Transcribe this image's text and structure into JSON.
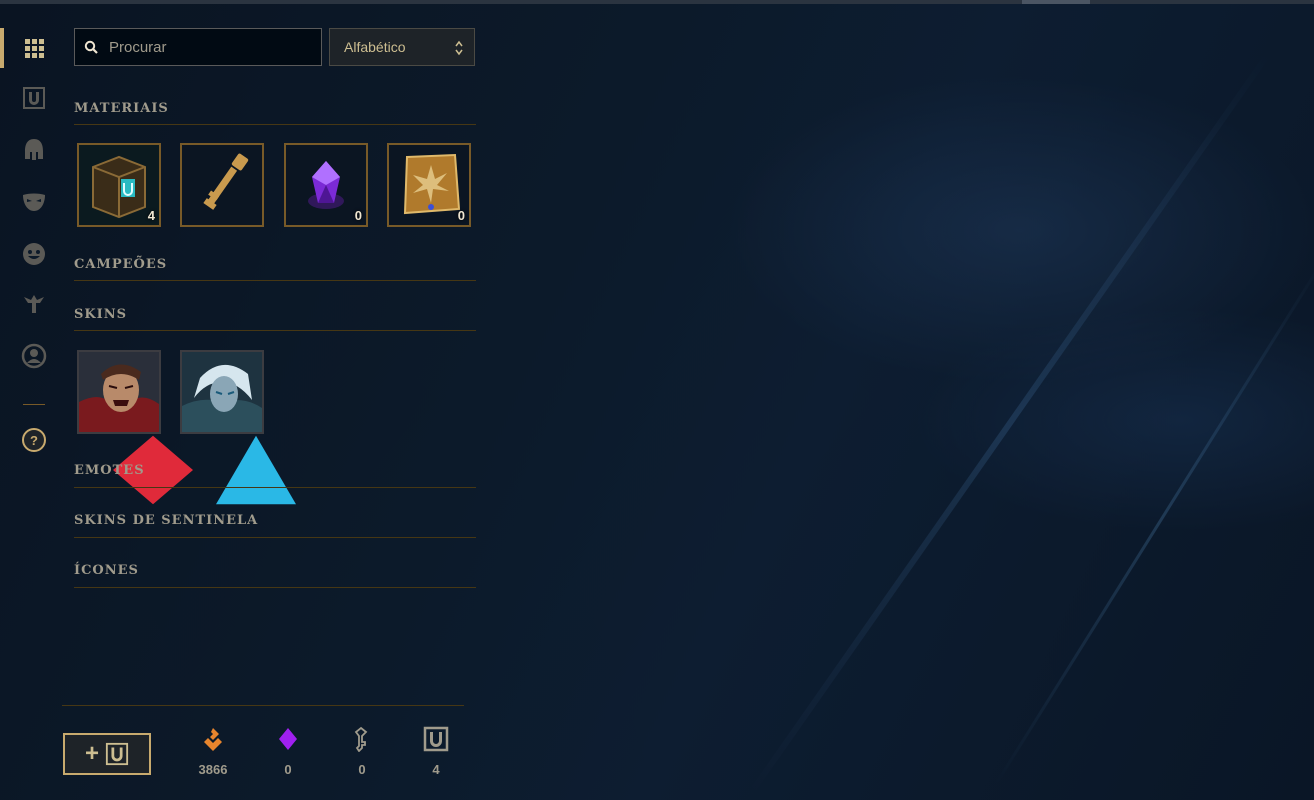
{
  "search": {
    "placeholder": "Procurar"
  },
  "sort": {
    "selected": "Alfabético"
  },
  "sidebar": {
    "items": [
      {
        "icon": "grid-icon",
        "active": true
      },
      {
        "icon": "chest-icon",
        "active": false
      },
      {
        "icon": "helmet-icon",
        "active": false
      },
      {
        "icon": "mask-icon",
        "active": false
      },
      {
        "icon": "emote-face-icon",
        "active": false
      },
      {
        "icon": "ward-icon",
        "active": false
      },
      {
        "icon": "profile-icon",
        "active": false
      }
    ],
    "help_label": "?"
  },
  "sections": {
    "materials": "MATERIAIS",
    "champions": "CAMPEÕES",
    "skins": "SKINS",
    "emotes": "EMOTES",
    "ward_skins": "SKINS DE SENTINELA",
    "icons": "ÍCONES"
  },
  "materials": [
    {
      "name": "hextech-chest",
      "count": "4"
    },
    {
      "name": "hextech-key",
      "count": ""
    },
    {
      "name": "mythic-essence",
      "count": "0"
    },
    {
      "name": "masterwork-card",
      "count": "0"
    }
  ],
  "skins": [
    {
      "name": "skin-shard-1",
      "gem": "red"
    },
    {
      "name": "skin-shard-2",
      "gem": "blue"
    }
  ],
  "footer": {
    "open_button": "+",
    "currencies": [
      {
        "icon": "orange-essence-icon",
        "value": "3866"
      },
      {
        "icon": "mythic-essence-icon",
        "value": "0"
      },
      {
        "icon": "key-fragment-icon",
        "value": "0"
      },
      {
        "icon": "chest-count-icon",
        "value": "4"
      }
    ]
  },
  "colors": {
    "gold": "#c8aa6e",
    "gold_dark": "#785a28",
    "text": "#a09b8c",
    "orange_essence": "#e8852d",
    "mythic": "#a020f0"
  }
}
